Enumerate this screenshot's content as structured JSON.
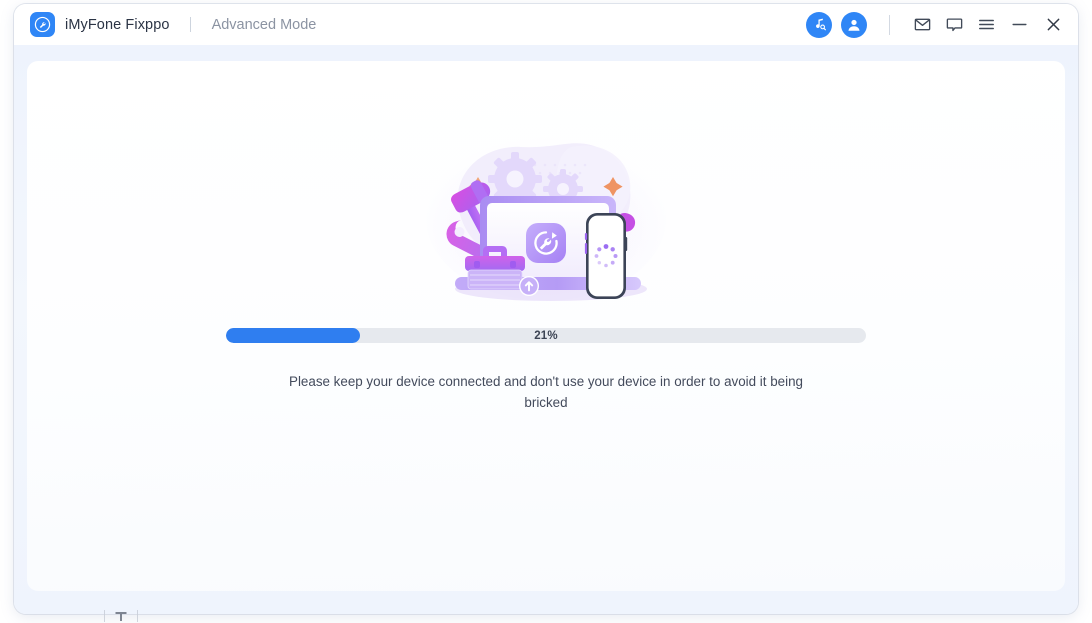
{
  "window": {
    "brand_name": "iMyFone Fixppo",
    "mode_label": "Advanced Mode",
    "logo_icon": "wrench-circle-icon"
  },
  "titlebar": {
    "music_search_icon": "music-search-icon",
    "account_icon": "user-account-icon",
    "mail_icon": "mail-icon",
    "feedback_icon": "chat-bubble-icon",
    "menu_icon": "hamburger-menu-icon",
    "minimize_icon": "minimize-icon",
    "close_icon": "close-icon"
  },
  "main": {
    "illustration_name": "device-repair-illustration",
    "progress": {
      "percent": 21,
      "percent_label": "21%",
      "fill_color": "#2f7ef0",
      "track_color": "#e6e9ee"
    },
    "hint_text": "Please keep your device connected and don't use your device in order to avoid it being bricked"
  },
  "colors": {
    "brand_blue": "#2f86f6",
    "title_text": "#2b3445",
    "muted_text": "#8b93a2",
    "body_bg": "#eef3fd",
    "illustration_purple": "#8b5cf6",
    "illustration_magenta": "#c04ee0",
    "sparkle_orange": "#f59b6a"
  }
}
